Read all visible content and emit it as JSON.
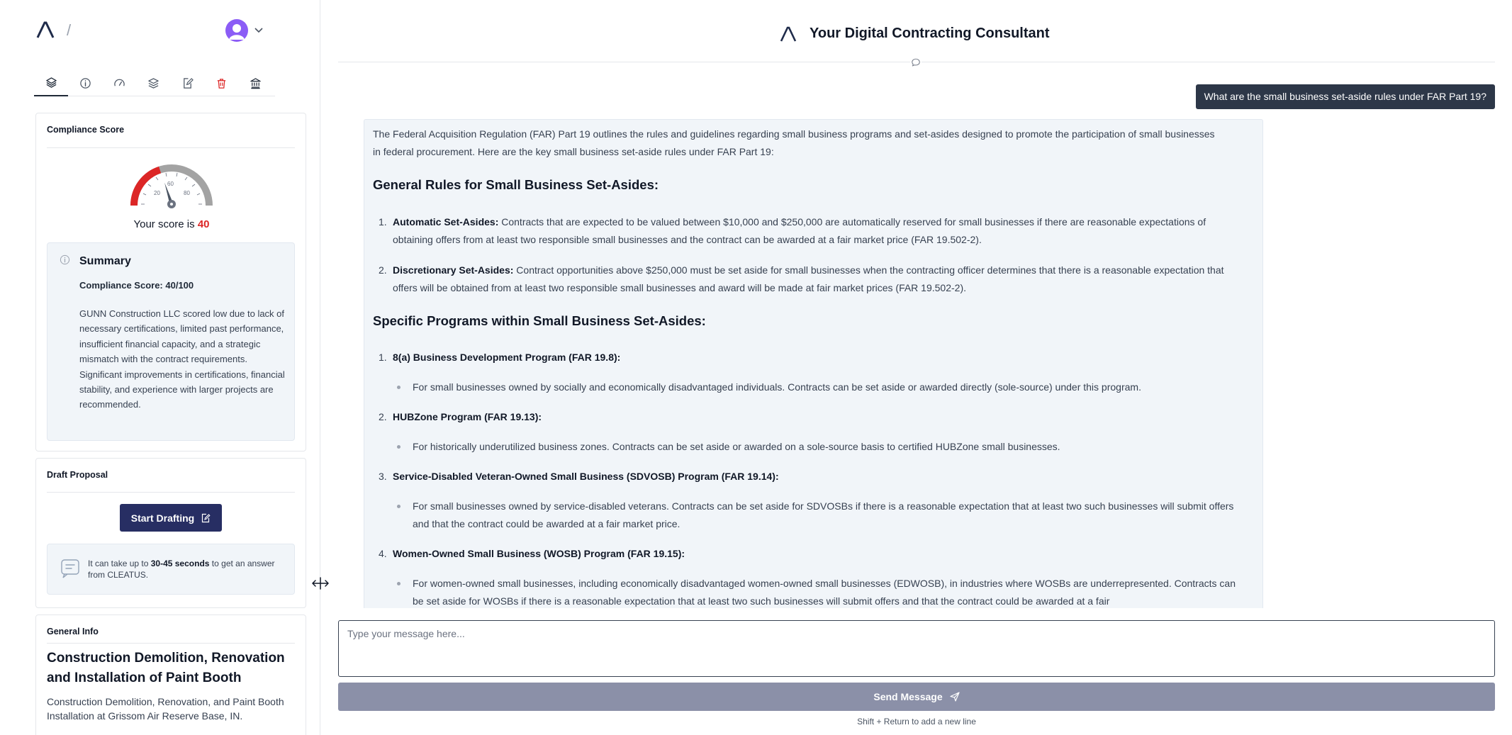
{
  "sidebar": {
    "breadcrumb_separator": "/",
    "tabs": [
      {
        "icon": "layers-icon"
      },
      {
        "icon": "info-icon"
      },
      {
        "icon": "gauge-icon"
      },
      {
        "icon": "stack-icon"
      },
      {
        "icon": "edit-document-icon"
      },
      {
        "icon": "trash-icon"
      },
      {
        "icon": "bank-icon"
      }
    ],
    "compliance": {
      "title": "Compliance Score",
      "gauge_ticks": [
        "20",
        "60",
        "80"
      ],
      "score_prefix": "Your score is",
      "score_value": "40",
      "score_fraction": 0.4,
      "summary_title": "Summary",
      "summary_score": "Compliance Score: 40/100",
      "summary_text": "GUNN Construction LLC scored low due to lack of necessary certifications, limited past performance, insufficient financial capacity, and a strategic mismatch with the contract requirements. Significant improvements in certifications, financial stability, and experience with larger projects are recommended."
    },
    "draft": {
      "title": "Draft Proposal",
      "button_label": "Start Drafting",
      "wait_prefix": "It can take up to",
      "wait_time": "30-45 seconds",
      "wait_suffix": "to get an answer from CLEATUS."
    },
    "general": {
      "title": "General Info",
      "project_title": "Construction Demolition, Renovation and Installation of Paint Booth",
      "project_desc": "Construction Demolition, Renovation, and Paint Booth Installation at Grissom Air Reserve Base, IN."
    }
  },
  "header": {
    "title": "Your Digital Contracting Consultant"
  },
  "chat": {
    "user_message": "What are the small business set-aside rules under FAR Part 19?",
    "intro": "The Federal Acquisition Regulation (FAR) Part 19 outlines the rules and guidelines regarding small business programs and set-asides designed to promote the participation of small businesses in federal procurement. Here are the key small business set-aside rules under FAR Part 19:",
    "heading1": "General Rules for Small Business Set-Asides:",
    "rules": [
      {
        "num": "1.",
        "term": "Automatic Set-Asides:",
        "text": "Contracts that are expected to be valued between $10,000 and $250,000 are automatically reserved for small businesses if there are reasonable expectations of obtaining offers from at least two responsible small businesses and the contract can be awarded at a fair market price (FAR 19.502-2)."
      },
      {
        "num": "2.",
        "term": "Discretionary Set-Asides:",
        "text": "Contract opportunities above $250,000 must be set aside for small businesses when the contracting officer determines that there is a reasonable expectation that offers will be obtained from at least two responsible small businesses and award will be made at fair market prices (FAR 19.502-2)."
      }
    ],
    "heading2": "Specific Programs within Small Business Set-Asides:",
    "programs": [
      {
        "num": "1.",
        "term": "8(a) Business Development Program (FAR 19.8):",
        "bullet": "For small businesses owned by socially and economically disadvantaged individuals. Contracts can be set aside or awarded directly (sole-source) under this program."
      },
      {
        "num": "2.",
        "term": "HUBZone Program (FAR 19.13):",
        "bullet": "For historically underutilized business zones. Contracts can be set aside or awarded on a sole-source basis to certified HUBZone small businesses."
      },
      {
        "num": "3.",
        "term": "Service-Disabled Veteran-Owned Small Business (SDVOSB) Program (FAR 19.14):",
        "bullet": "For small businesses owned by service-disabled veterans. Contracts can be set aside for SDVOSBs if there is a reasonable expectation that at least two such businesses will submit offers and that the contract could be awarded at a fair market price."
      },
      {
        "num": "4.",
        "term": "Women-Owned Small Business (WOSB) Program (FAR 19.15):",
        "bullet": "For women-owned small businesses, including economically disadvantaged women-owned small businesses (EDWOSB), in industries where WOSBs are underrepresented. Contracts can be set aside for WOSBs if there is a reasonable expectation that at least two such businesses will submit offers and that the contract could be awarded at a fair"
      }
    ]
  },
  "composer": {
    "placeholder": "Type your message here...",
    "send_label": "Send Message",
    "hint": "Shift + Return to add a new line"
  },
  "colors": {
    "accent": "#272e63",
    "score_red": "#dc2626",
    "user_bubble": "#2d3748",
    "send_disabled": "#8b90a8"
  }
}
